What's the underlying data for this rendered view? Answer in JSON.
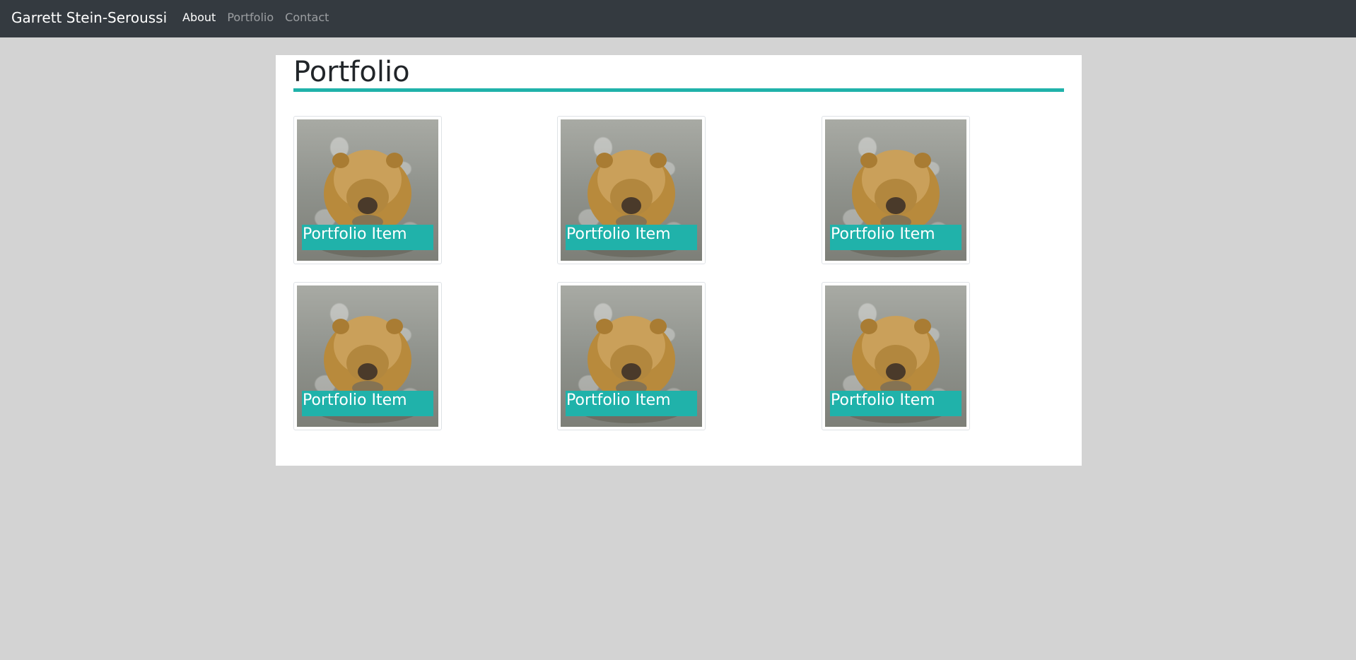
{
  "navbar": {
    "brand": "Garrett Stein-Seroussi",
    "links": [
      {
        "label": "About",
        "active": true
      },
      {
        "label": "Portfolio",
        "active": false
      },
      {
        "label": "Contact",
        "active": false
      }
    ]
  },
  "main": {
    "title": "Portfolio",
    "items": [
      {
        "caption": "Portfolio Item"
      },
      {
        "caption": "Portfolio Item"
      },
      {
        "caption": "Portfolio Item"
      },
      {
        "caption": "Portfolio Item"
      },
      {
        "caption": "Portfolio Item"
      },
      {
        "caption": "Portfolio Item"
      }
    ]
  },
  "colors": {
    "navbar_bg": "#343a40",
    "page_bg": "#d3d3d3",
    "accent": "#20b2aa"
  }
}
